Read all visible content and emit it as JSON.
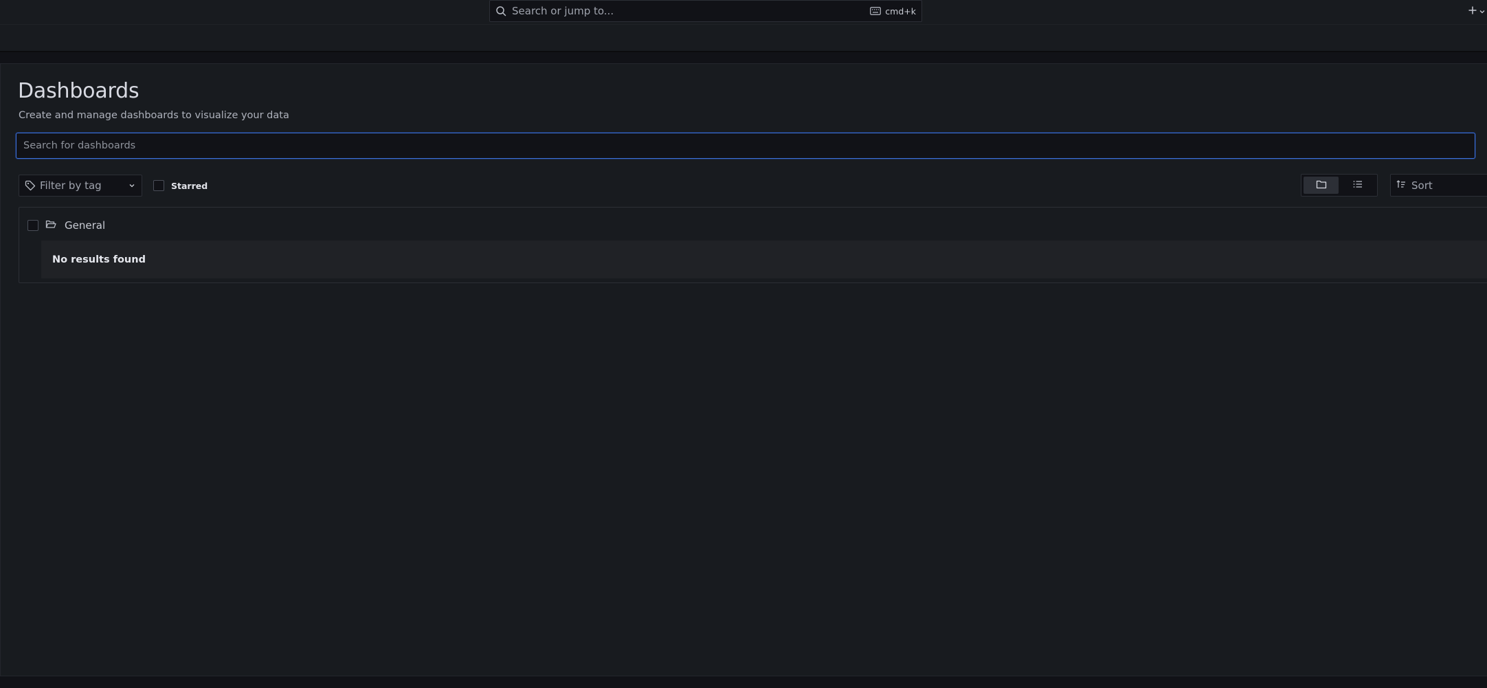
{
  "topbar": {
    "search_placeholder": "Search or jump to...",
    "shortcut": "cmd+k",
    "icons": {
      "search": "search-icon",
      "keyboard": "keyboard-icon",
      "plus": "plus-icon",
      "chevron": "chevron-down-icon"
    }
  },
  "page": {
    "title": "Dashboards",
    "subtitle": "Create and manage dashboards to visualize your data",
    "search_placeholder": "Search for dashboards"
  },
  "filters": {
    "tag_placeholder": "Filter by tag",
    "starred_label": "Starred",
    "view_mode": "folders",
    "sort_label": "Sort"
  },
  "results": {
    "folders": [
      {
        "name": "General",
        "empty_message": "No results found"
      }
    ]
  },
  "colors": {
    "background": "#111217",
    "panel": "#181b1f",
    "focus_border": "#3d71d9",
    "text_primary": "#ccccdc"
  }
}
